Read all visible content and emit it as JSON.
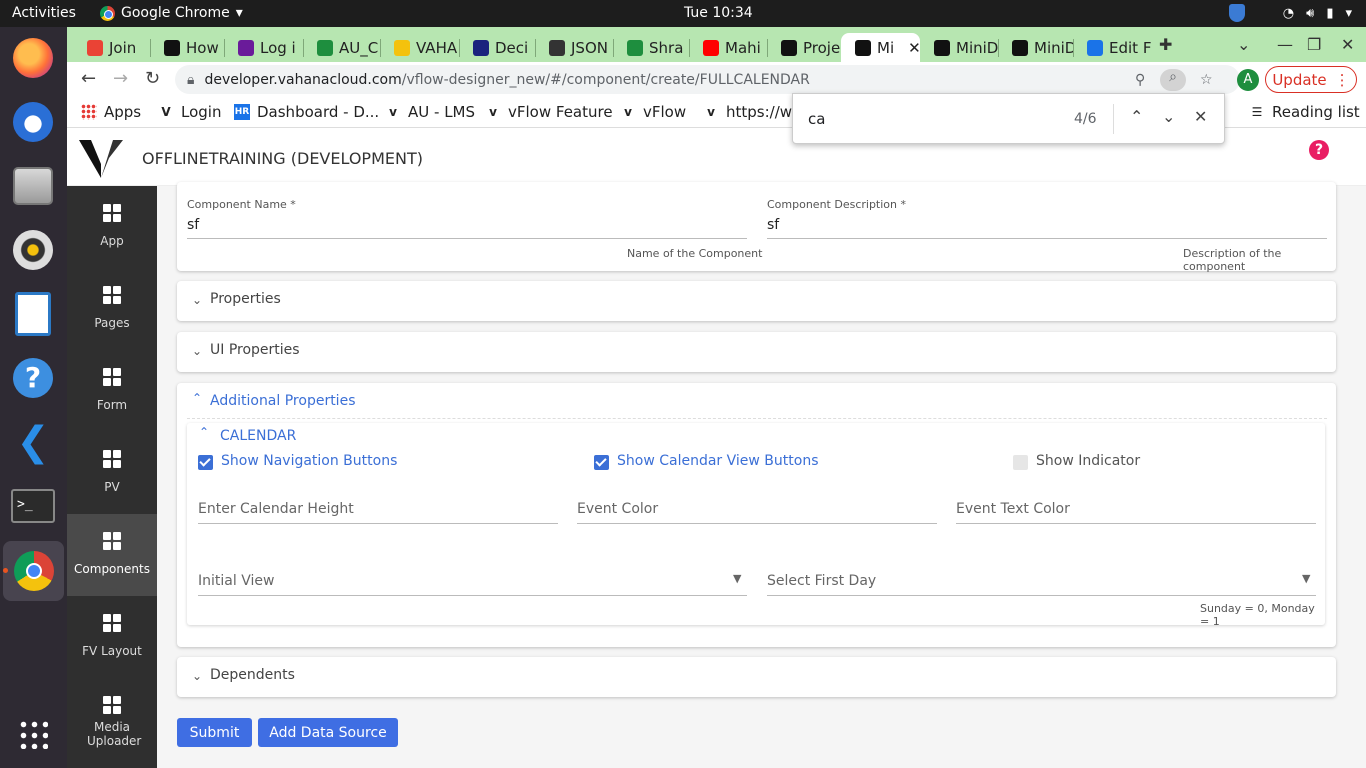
{
  "os": {
    "activities": "Activities",
    "app_name": "Google Chrome",
    "clock": "Tue 10:34"
  },
  "dock": {
    "items": [
      "firefox",
      "thunderbird",
      "files",
      "rhythmbox",
      "libreoffice-writer",
      "help",
      "vscode",
      "terminal",
      "chrome",
      "show-apps"
    ]
  },
  "browser": {
    "tabs": [
      {
        "label": "Join",
        "icon": "gmail-icon",
        "color": "#ea4335"
      },
      {
        "label": "How",
        "icon": "imdb-icon",
        "color": "#111111"
      },
      {
        "label": "Log i",
        "icon": "log-icon",
        "color": "#6a1b9a"
      },
      {
        "label": "AU_C",
        "icon": "app-icon",
        "color": "#1e8e3e"
      },
      {
        "label": "VAHA",
        "icon": "yellow-icon",
        "color": "#f4c20d"
      },
      {
        "label": "Deci",
        "icon": "d-icon",
        "color": "#1a237e"
      },
      {
        "label": "JSON",
        "icon": "braces-icon",
        "color": "#333333"
      },
      {
        "label": "Shra",
        "icon": "app-icon",
        "color": "#1e8e3e"
      },
      {
        "label": "Mahi",
        "icon": "youtube-icon",
        "color": "#ff0000"
      },
      {
        "label": "Proje",
        "icon": "v-icon",
        "color": "#111111"
      },
      {
        "label": "Mi",
        "icon": "v-icon",
        "color": "#111111"
      },
      {
        "label": "MiniD",
        "icon": "v-icon",
        "color": "#111111"
      },
      {
        "label": "MiniD",
        "icon": "v-icon",
        "color": "#111111"
      },
      {
        "label": "Edit F",
        "icon": "edit-icon",
        "color": "#1a73e8"
      }
    ],
    "url_host": "developer.vahanacloud.com",
    "url_path": "/vflow-designer_new/#/component/create/FULLCALENDAR",
    "avatar_letter": "A",
    "update_label": "Update",
    "bookmarks": [
      "Apps",
      "Login",
      "Dashboard - D...",
      "AU - LMS",
      "vFlow Feature",
      "vFlow",
      "https://w"
    ],
    "reading_list": "Reading list",
    "find": {
      "query": "ca",
      "count": "4/6"
    }
  },
  "app": {
    "title": "OFFLINETRAINING (DEVELOPMENT)",
    "help": "?",
    "nav": [
      {
        "label": "App"
      },
      {
        "label": "Pages"
      },
      {
        "label": "Form"
      },
      {
        "label": "PV"
      },
      {
        "label": "Components"
      },
      {
        "label": "FV Layout"
      },
      {
        "label": "Media Uploader"
      }
    ],
    "form": {
      "component_name_label": "Component Name *",
      "component_name_value": "sf",
      "component_name_hint": "Name of the Component",
      "component_desc_label": "Component Description *",
      "component_desc_value": "sf",
      "component_desc_hint": "Description of the component"
    },
    "panels": {
      "properties": "Properties",
      "ui_properties": "UI Properties",
      "additional_properties": "Additional Properties",
      "calendar": "CALENDAR",
      "dependents": "Dependents"
    },
    "calendar": {
      "show_nav_buttons": "Show Navigation Buttons",
      "show_view_buttons": "Show Calendar View Buttons",
      "show_indicator": "Show Indicator",
      "height_placeholder": "Enter Calendar Height",
      "event_color": "Event Color",
      "event_text_color": "Event Text Color",
      "initial_view": "Initial View",
      "first_day": "Select First Day",
      "first_day_hint": "Sunday = 0, Monday = 1"
    },
    "buttons": {
      "submit": "Submit",
      "add_data_source": "Add Data Source"
    }
  }
}
